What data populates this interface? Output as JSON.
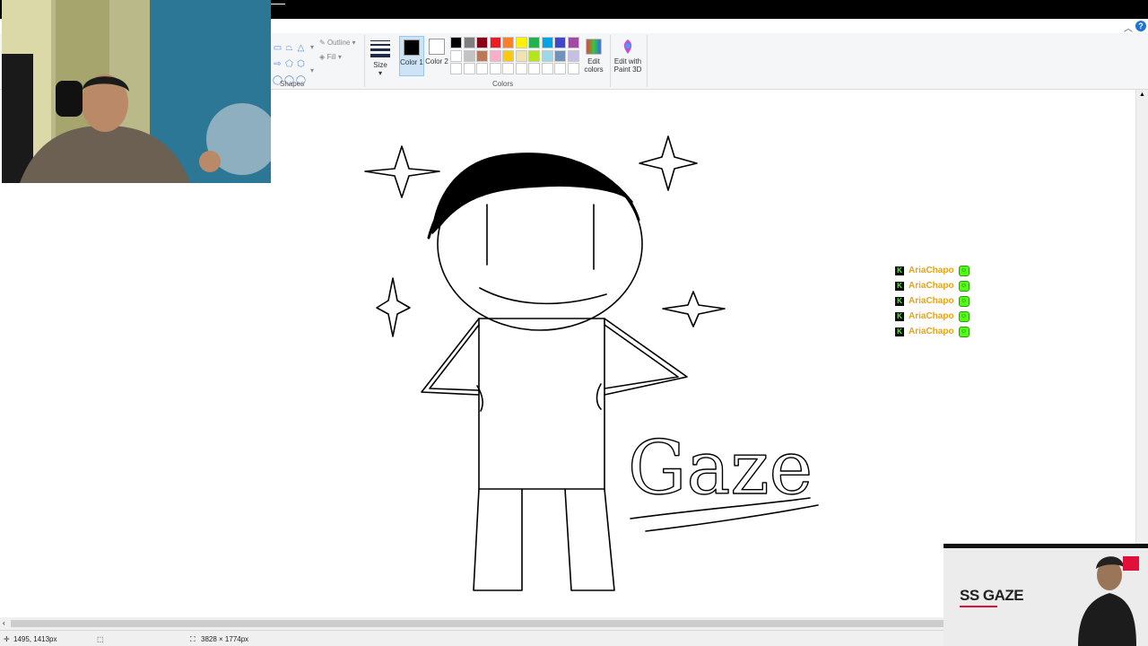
{
  "ribbon": {
    "shapes_label": "Shapes",
    "outline_label": "Outline",
    "fill_label": "Fill",
    "size_label": "Size",
    "color1_label": "Color 1",
    "color2_label": "Color 2",
    "colors_label": "Colors",
    "edit_colors_label": "Edit colors",
    "paint3d_label": "Edit with Paint 3D",
    "color1_value": "#000000",
    "color2_value": "#ffffff",
    "palette": [
      "#000000",
      "#7f7f7f",
      "#880015",
      "#ed1c24",
      "#ff7f27",
      "#fff200",
      "#22b14c",
      "#00a2e8",
      "#3f48cc",
      "#a349a4",
      "#ffffff",
      "#c3c3c3",
      "#b97a57",
      "#ffaec9",
      "#ffc90e",
      "#efe4b0",
      "#b5e61d",
      "#99d9ea",
      "#7092be",
      "#c8bfe7",
      "#ffffff",
      "#ffffff",
      "#ffffff",
      "#ffffff",
      "#ffffff",
      "#ffffff",
      "#ffffff",
      "#ffffff",
      "#ffffff",
      "#ffffff"
    ]
  },
  "drawing": {
    "signature_text": "Gaze"
  },
  "chat": {
    "messages": [
      {
        "user": "AriaChapo"
      },
      {
        "user": "AriaChapo"
      },
      {
        "user": "AriaChapo"
      },
      {
        "user": "AriaChapo"
      },
      {
        "user": "AriaChapo"
      }
    ],
    "user_color": "#e8a317",
    "badge_color": "#53fc18"
  },
  "overlay": {
    "brand_text": "SS GAZE"
  },
  "status": {
    "cursor_pos": "1495, 1413px",
    "canvas_size": "3828 × 1774px"
  }
}
